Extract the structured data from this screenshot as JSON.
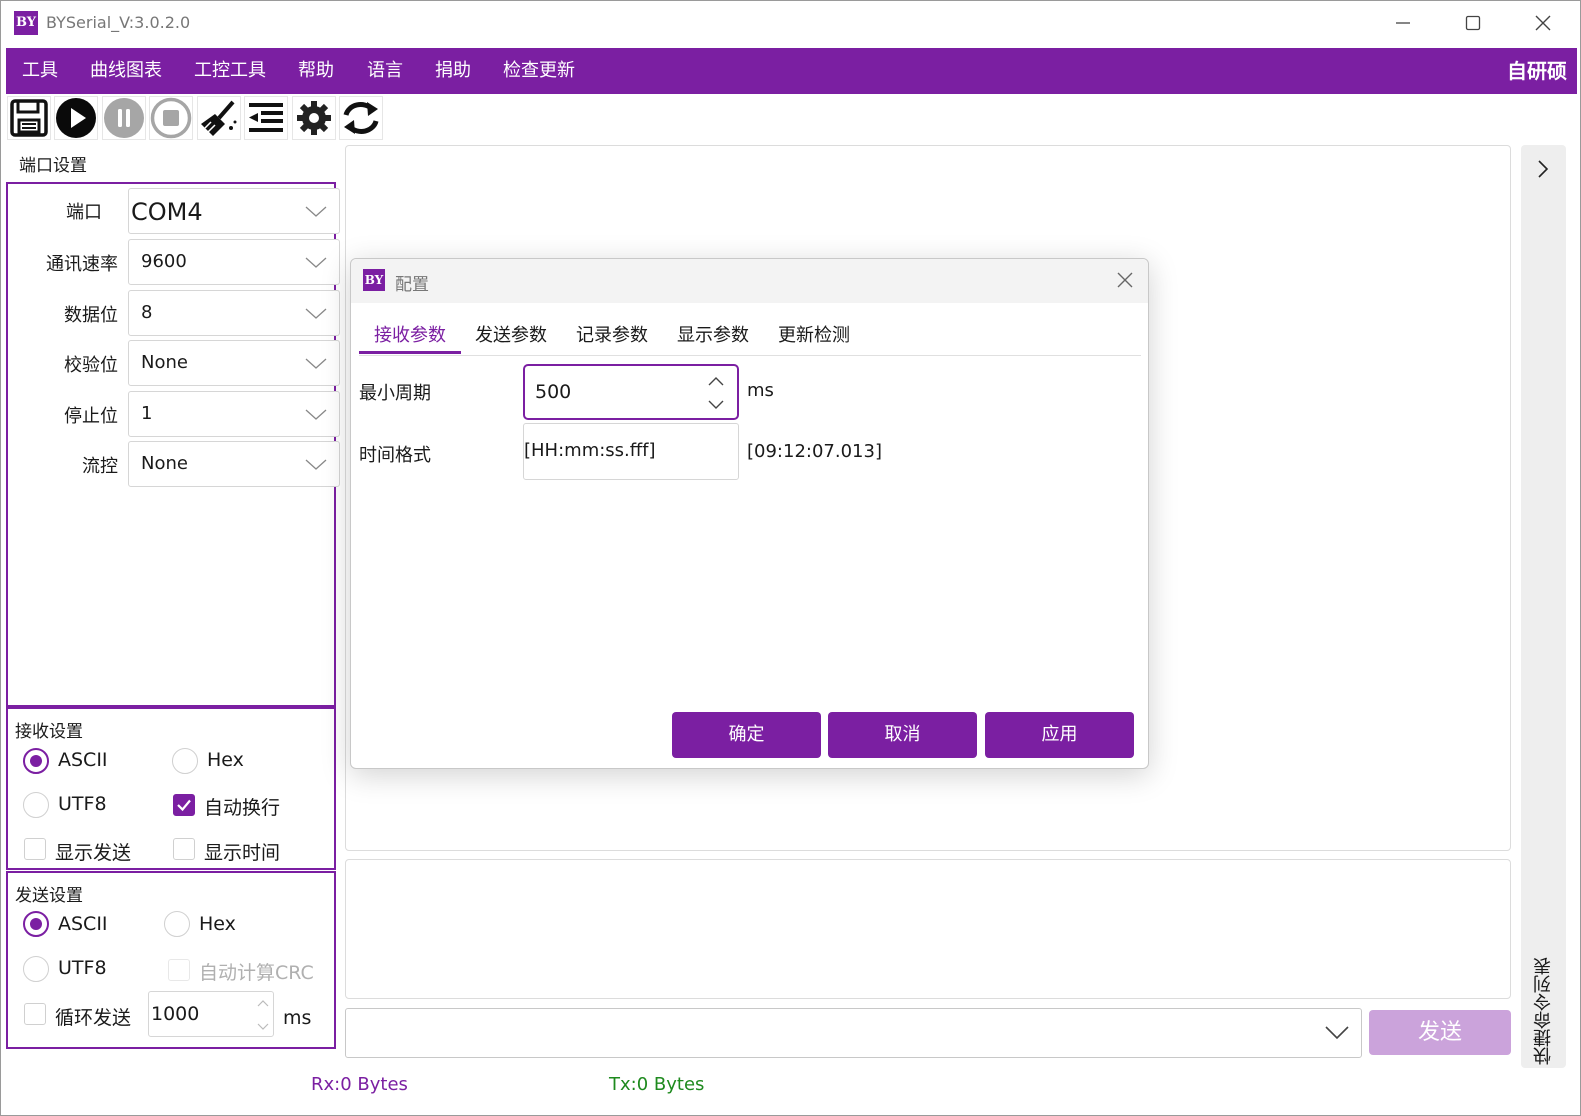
{
  "window": {
    "title": "BYSerial_V:3.0.2.0",
    "logo_text": "BY"
  },
  "menu": {
    "items": [
      "工具",
      "曲线图表",
      "工控工具",
      "帮助",
      "语言",
      "捐助",
      "检查更新"
    ],
    "brand": "自研硕"
  },
  "toolbar": {
    "buttons": [
      "save-icon",
      "play-icon",
      "pause-icon",
      "stop-icon",
      "clear-icon",
      "indent-icon",
      "gear-icon",
      "refresh-icon"
    ]
  },
  "port_settings": {
    "title": "端口设置",
    "fields": [
      {
        "label": "端口",
        "value": "COM4"
      },
      {
        "label": "通讯速率",
        "value": "9600"
      },
      {
        "label": "数据位",
        "value": "8"
      },
      {
        "label": "校验位",
        "value": "None"
      },
      {
        "label": "停止位",
        "value": "1"
      },
      {
        "label": "流控",
        "value": "None"
      }
    ]
  },
  "receive_settings": {
    "title": "接收设置",
    "ascii": "ASCII",
    "hex": "Hex",
    "utf8": "UTF8",
    "auto_newline": "自动换行",
    "show_send": "显示发送",
    "show_time": "显示时间",
    "selected": "ASCII",
    "auto_newline_checked": true
  },
  "send_settings": {
    "title": "发送设置",
    "ascii": "ASCII",
    "hex": "Hex",
    "utf8": "UTF8",
    "auto_crc": "自动计算CRC",
    "loop_send": "循环发送",
    "loop_interval": "1000",
    "unit": "ms",
    "selected": "ASCII"
  },
  "send_bar": {
    "button": "发送",
    "input": ""
  },
  "side_panel": {
    "label": "快捷命令列表"
  },
  "status": {
    "rx": "Rx:0 Bytes",
    "tx": "Tx:0 Bytes"
  },
  "dialog": {
    "title": "配置",
    "logo_text": "BY",
    "tabs": [
      "接收参数",
      "发送参数",
      "记录参数",
      "显示参数",
      "更新检测"
    ],
    "active_tab": "接收参数",
    "min_period_label": "最小周期",
    "min_period_value": "500",
    "min_period_unit": "ms",
    "time_format_label": "时间格式",
    "time_format_value": "[HH:mm:ss.fff]",
    "time_format_preview": "[09:12:07.013]",
    "buttons": {
      "ok": "确定",
      "cancel": "取消",
      "apply": "应用"
    }
  },
  "colors": {
    "accent": "#7b1fa2",
    "send_disabled": "#cba3db",
    "tx_green": "#1e8a1e"
  }
}
